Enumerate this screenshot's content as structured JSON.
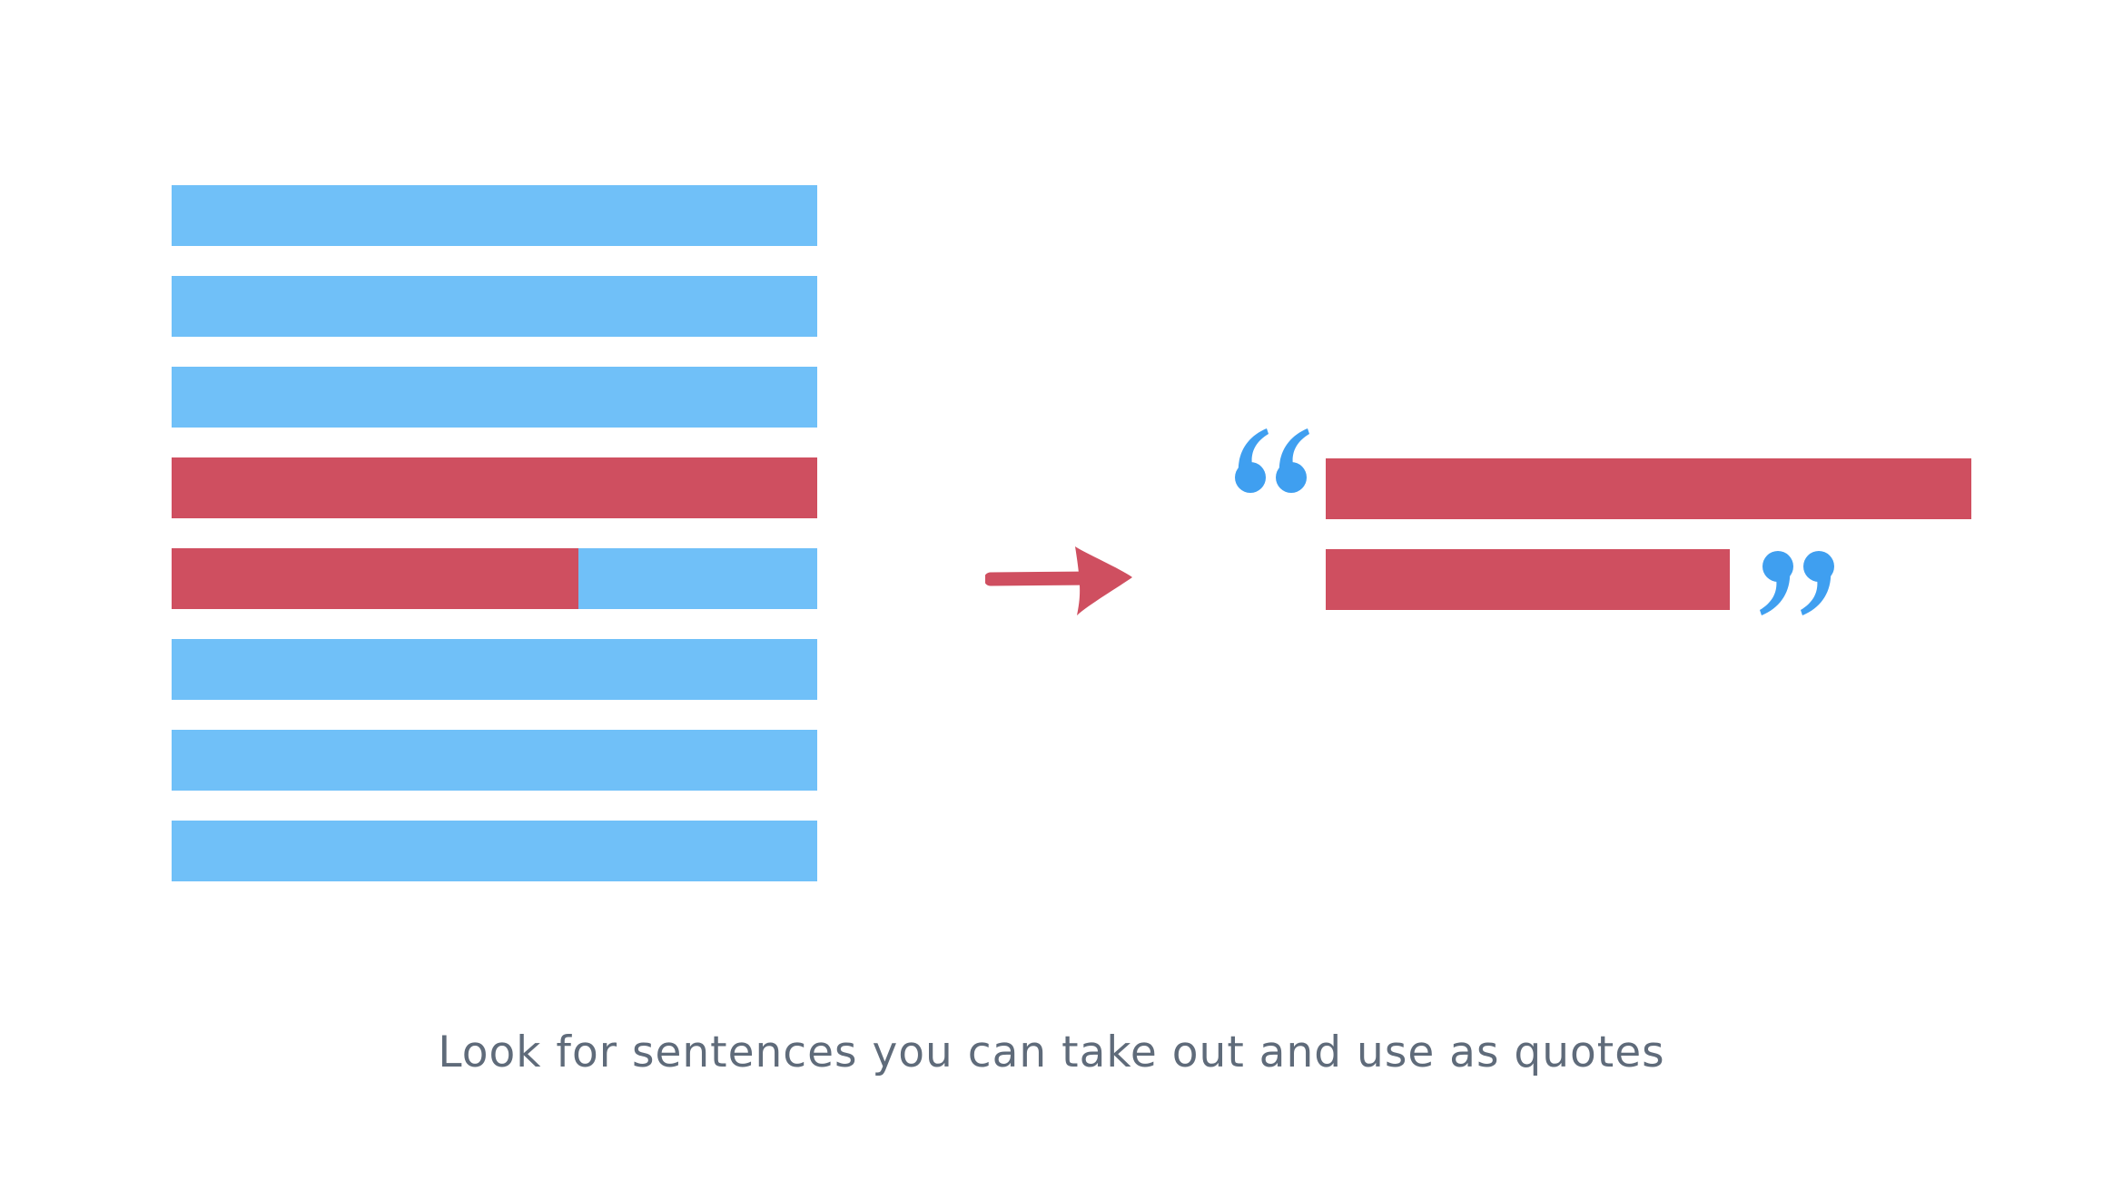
{
  "caption": "Look for sentences you can take out and use as quotes",
  "colors": {
    "text_line": "#70c0f8",
    "highlight": "#cf4f60",
    "quote_mark": "#3f9ff0",
    "caption": "#5f6b7a",
    "background": "#ffffff"
  },
  "document_lines": [
    {
      "highlight_fraction": 0
    },
    {
      "highlight_fraction": 0
    },
    {
      "highlight_fraction": 0
    },
    {
      "highlight_fraction": 1
    },
    {
      "highlight_fraction": 0.63
    },
    {
      "highlight_fraction": 0
    },
    {
      "highlight_fraction": 0
    },
    {
      "highlight_fraction": 0
    }
  ],
  "icons": {
    "arrow": "right-arrow-icon",
    "open_quote": "open-quote-icon",
    "close_quote": "close-quote-icon"
  }
}
